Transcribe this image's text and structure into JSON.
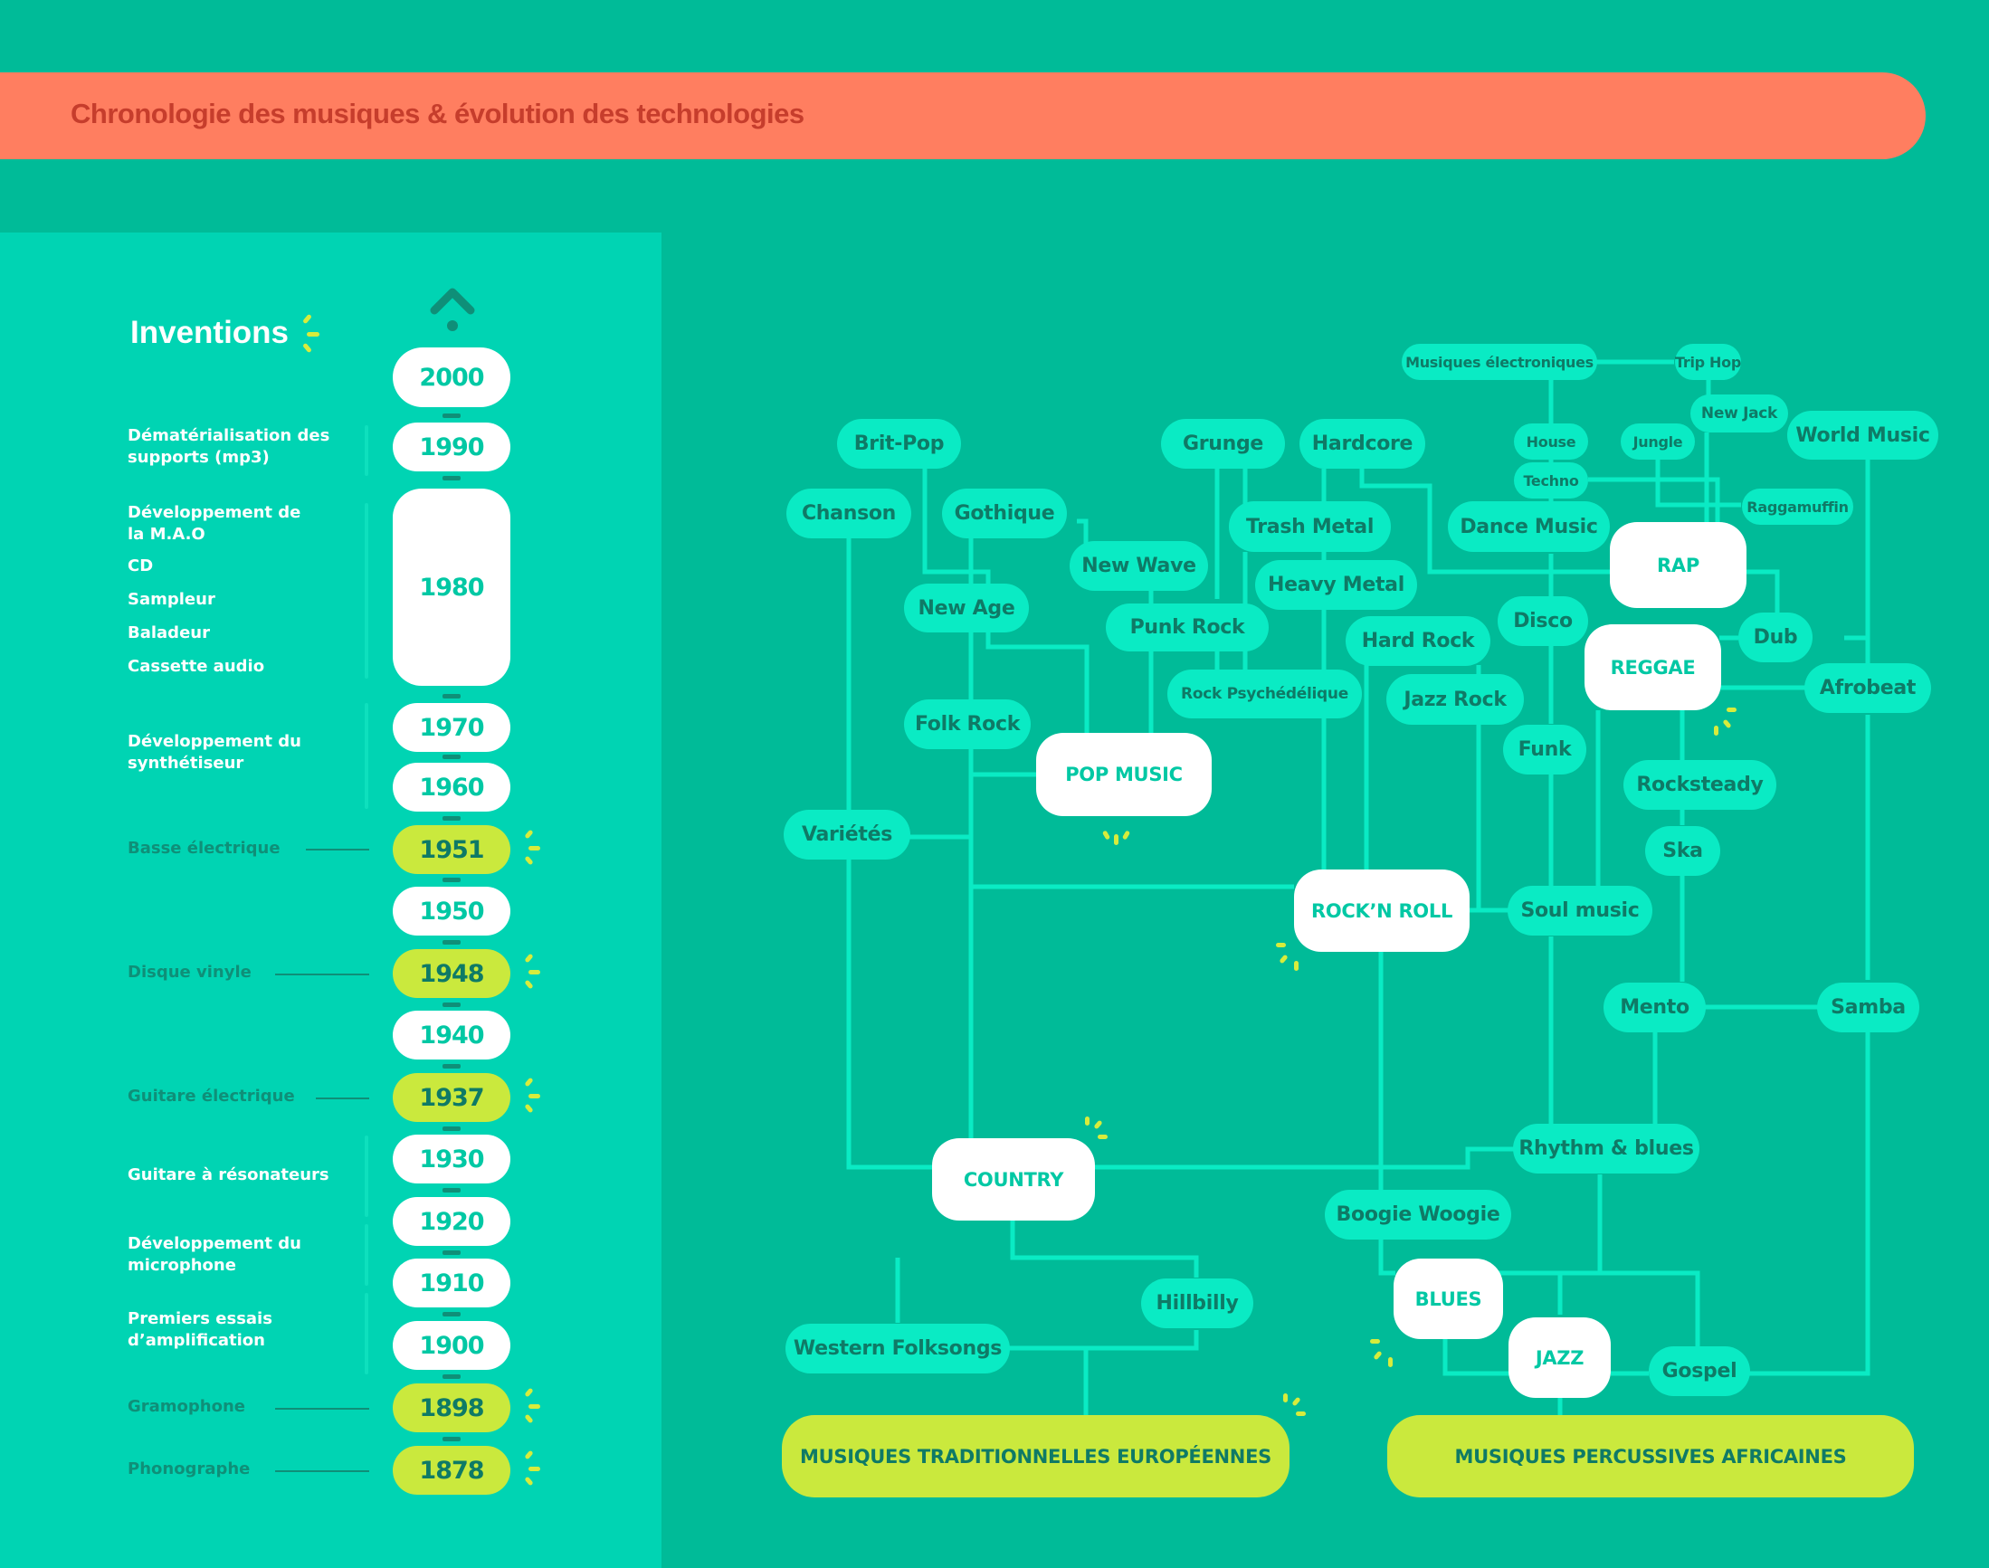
{
  "header": {
    "title": "Chronologie des musiques & évolution des technologies"
  },
  "colors": {
    "background": "#00bb98",
    "panel": "#00d4b3",
    "banner": "#ff7e60",
    "banner_text": "#c63d2c",
    "node": "#0aebc4",
    "node_text": "#0f7a66",
    "highlight": "#cae93d",
    "accent_text": "#00c8a4",
    "line": "#0aebc4"
  },
  "inventions_panel": {
    "title": "Inventions",
    "top_icon": "up-arrow-icon",
    "years": [
      {
        "label": "2000",
        "highlight": false
      },
      {
        "label": "1990",
        "highlight": false
      },
      {
        "label": "1980",
        "highlight": false
      },
      {
        "label": "1970",
        "highlight": false
      },
      {
        "label": "1960",
        "highlight": false
      },
      {
        "label": "1951",
        "highlight": true
      },
      {
        "label": "1950",
        "highlight": false
      },
      {
        "label": "1948",
        "highlight": true
      },
      {
        "label": "1940",
        "highlight": false
      },
      {
        "label": "1937",
        "highlight": true
      },
      {
        "label": "1930",
        "highlight": false
      },
      {
        "label": "1920",
        "highlight": false
      },
      {
        "label": "1910",
        "highlight": false
      },
      {
        "label": "1900",
        "highlight": false
      },
      {
        "label": "1898",
        "highlight": true
      },
      {
        "label": "1878",
        "highlight": true
      }
    ],
    "inventions": [
      {
        "text": "Dématérialisation des supports (mp3)",
        "year": "1990"
      },
      {
        "text": "Développement de la M.A.O",
        "year": "1980"
      },
      {
        "text": "CD",
        "year": "1980"
      },
      {
        "text": "Sampleur",
        "year": "1980"
      },
      {
        "text": "Baladeur",
        "year": "1980"
      },
      {
        "text": "Cassette audio",
        "year": "1980"
      },
      {
        "text": "Développement du synthétiseur",
        "year": "1970-1960"
      },
      {
        "text": "Basse électrique",
        "year": "1951"
      },
      {
        "text": "Disque vinyle",
        "year": "1948"
      },
      {
        "text": "Guitare électrique",
        "year": "1937"
      },
      {
        "text": "Guitare à résonateurs",
        "year": "1930"
      },
      {
        "text": "Développement du microphone",
        "year": "1920-1910"
      },
      {
        "text": "Premiers essais d’amplification",
        "year": "1900"
      },
      {
        "text": "Gramophone",
        "year": "1898"
      },
      {
        "text": "Phonographe",
        "year": "1878"
      }
    ]
  },
  "diagram": {
    "main_genres": [
      "POP MUSIC",
      "ROCK’N ROLL",
      "RAP",
      "REGGAE",
      "COUNTRY",
      "BLUES",
      "JAZZ"
    ],
    "roots": [
      "MUSIQUES TRADITIONNELLES EUROPÉENNES",
      "MUSIQUES PERCUSSIVES AFRICAINES"
    ],
    "nodes": {
      "musiques_electroniques": "Musiques électroniques",
      "trip_hop": "Trip Hop",
      "new_jack": "New Jack",
      "house": "House",
      "jungle": "Jungle",
      "techno": "Techno",
      "raggamuffin": "Raggamuffin",
      "world_music": "World Music",
      "brit_pop": "Brit-Pop",
      "grunge": "Grunge",
      "hardcore": "Hardcore",
      "chanson": "Chanson",
      "gothique": "Gothique",
      "trash_metal": "Trash Metal",
      "dance_music": "Dance Music",
      "rap": "RAP",
      "new_wave": "New Wave",
      "heavy_metal": "Heavy Metal",
      "new_age": "New Age",
      "punk_rock": "Punk Rock",
      "hard_rock": "Hard Rock",
      "disco": "Disco",
      "dub": "Dub",
      "reggae": "REGGAE",
      "rock_psychedelique": "Rock Psychédélique",
      "jazz_rock": "Jazz Rock",
      "afrobeat": "Afrobeat",
      "folk_rock": "Folk Rock",
      "pop_music": "POP MUSIC",
      "funk": "Funk",
      "rocksteady": "Rocksteady",
      "varietes": "Variétés",
      "ska": "Ska",
      "rock_n_roll": "ROCK’N ROLL",
      "soul_music": "Soul music",
      "mento": "Mento",
      "samba": "Samba",
      "country": "COUNTRY",
      "rhythm_blues": "Rhythm & blues",
      "boogie_woogie": "Boogie Woogie",
      "hillbilly": "Hillbilly",
      "blues": "BLUES",
      "western_folksongs": "Western Folksongs",
      "jazz": "JAZZ",
      "gospel": "Gospel",
      "trad_euro": "MUSIQUES TRADITIONNELLES EUROPÉENNES",
      "perc_afr": "MUSIQUES PERCUSSIVES AFRICAINES"
    }
  }
}
